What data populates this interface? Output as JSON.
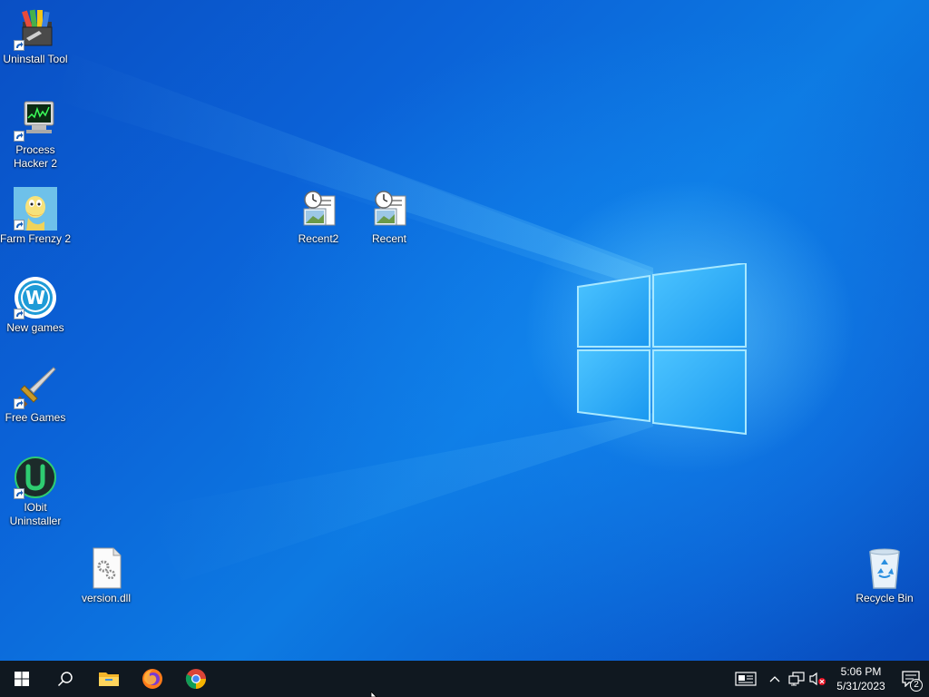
{
  "desktop": {
    "icons": [
      {
        "label": "Uninstall Tool",
        "icon": "uninstall-tool-icon",
        "shortcut": true
      },
      {
        "label": "Process Hacker 2",
        "icon": "process-hacker-icon",
        "shortcut": true
      },
      {
        "label": "Farm Frenzy 2",
        "icon": "farm-frenzy-icon",
        "shortcut": true
      },
      {
        "label": "New games",
        "icon": "new-games-icon",
        "shortcut": true
      },
      {
        "label": "Free Games",
        "icon": "free-games-icon",
        "shortcut": true
      },
      {
        "label": "IObit Uninstaller",
        "icon": "iobit-uninstaller-icon",
        "shortcut": true
      },
      {
        "label": "version.dll",
        "icon": "dll-file-icon",
        "shortcut": false
      },
      {
        "label": "Recent2",
        "icon": "recent-folder-icon",
        "shortcut": false
      },
      {
        "label": "Recent",
        "icon": "recent-folder-icon",
        "shortcut": false
      },
      {
        "label": "Recycle Bin",
        "icon": "recycle-bin-icon",
        "shortcut": false
      }
    ]
  },
  "taskbar": {
    "pinned": [
      "start-icon",
      "search-icon",
      "file-explorer-icon",
      "firefox-icon",
      "chrome-icon"
    ],
    "clock": {
      "time": "5:06 PM",
      "date": "5/31/2023"
    },
    "notification_count": "2",
    "tray": [
      "news-icon",
      "chevron-up-icon",
      "network-icon",
      "volume-muted-icon"
    ]
  },
  "colors": {
    "accent": "#0a63d6",
    "taskbar": "#101820",
    "logo_glow": "#7fd8ff"
  }
}
